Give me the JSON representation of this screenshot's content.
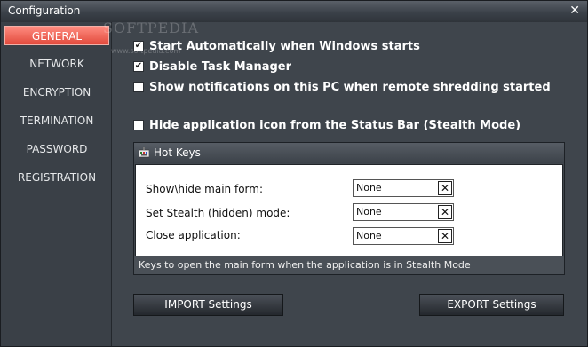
{
  "window": {
    "title": "Configuration",
    "close_glyph": "✕"
  },
  "watermark": {
    "main": "SOFTPEDIA",
    "sub": "www.softpedia.com"
  },
  "sidebar": {
    "items": [
      {
        "label": "GENERAL",
        "active": true
      },
      {
        "label": "NETWORK"
      },
      {
        "label": "ENCRYPTION"
      },
      {
        "label": "TERMINATION"
      },
      {
        "label": "PASSWORD"
      },
      {
        "label": "REGISTRATION"
      }
    ]
  },
  "options": [
    {
      "label": "Start Automatically when Windows starts",
      "checked": true
    },
    {
      "label": "Disable Task Manager",
      "checked": true
    },
    {
      "label": "Show notifications on this PC when remote shredding started",
      "checked": false
    },
    {
      "label": "Hide application icon from the Status Bar (Stealth Mode)",
      "checked": false
    }
  ],
  "hotkeys": {
    "title": "Hot Keys",
    "rows": [
      {
        "label": "Show\\hide main form:",
        "value": "None"
      },
      {
        "label": "Set Stealth (hidden) mode:",
        "value": "None"
      },
      {
        "label": "Close application:",
        "value": "None"
      }
    ],
    "footer": "Keys to open the main form when the application is in Stealth Mode",
    "clear_glyph": "✕"
  },
  "buttons": {
    "import": "IMPORT Settings",
    "export": "EXPORT Settings"
  },
  "colors": {
    "accent": "#e24a3c",
    "background": "#3f454c"
  }
}
